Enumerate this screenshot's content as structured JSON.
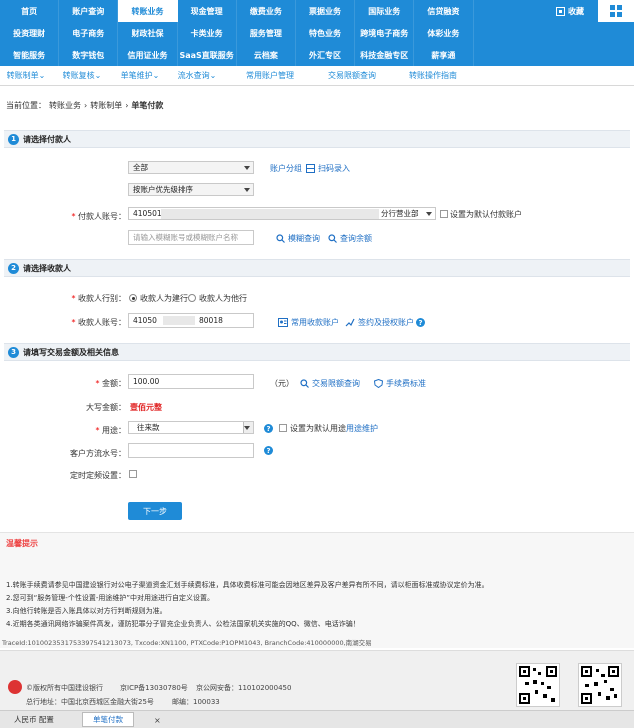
{
  "top_nav": {
    "row1": [
      "首页",
      "账户查询",
      "转账业务",
      "现金管理",
      "缴费业务",
      "票据业务",
      "国际业务",
      "信贷融资"
    ],
    "row2": [
      "投资理财",
      "电子商务",
      "财政社保",
      "卡类业务",
      "服务管理",
      "特色业务",
      "跨境电子商务",
      "体彩业务"
    ],
    "row3": [
      "智能服务",
      "数字钱包",
      "信用证业务",
      "SaaS直联服务",
      "云档案",
      "外汇专区",
      "科技金融专区",
      "薪享通"
    ],
    "active": "转账业务",
    "collect_label": "收藏"
  },
  "sub_nav": [
    "转账制单",
    "转账复核",
    "单笔维护",
    "流水查询",
    "常用账户管理",
    "交易限额查询",
    "转账操作指南"
  ],
  "breadcrumb": {
    "prefix": "当前位置：",
    "items": [
      "转账业务",
      "转账制单"
    ],
    "current": "单笔付款"
  },
  "section1": {
    "number": "1",
    "title": "请选择付款人",
    "select_all": "全部",
    "select_sort": "按账户优先级排序",
    "account_label": "付款人账号：",
    "account_prefix": "4105016",
    "account_suffix": "分行营业部",
    "set_default_label": "设置为默认付款账户",
    "search_placeholder": "请输入模糊账号或模糊账户名称",
    "link_group": "账户分组",
    "link_scan": "扫码录入",
    "link_fuzzy": "模糊查询",
    "link_balance": "查询余额"
  },
  "section2": {
    "number": "2",
    "title": "请选择收款人",
    "bank_label": "收款人行别：",
    "bank_option1": "收款人为建行",
    "bank_option2": "收款人为他行",
    "account_label": "收款人账号：",
    "account_prefix": "41050",
    "account_suffix": "80018",
    "link_common": "常用收款账户",
    "link_sign": "签约及授权账户"
  },
  "section3": {
    "number": "3",
    "title": "请填写交易金额及相关信息",
    "amount_label": "金额：",
    "amount_value": "100.00",
    "amount_unit": "（元）",
    "link_limit": "交易限额查询",
    "link_fee": "手续费标准",
    "upper_label": "大写金额：",
    "upper_value": "壹佰元整",
    "purpose_label": "用途：",
    "purpose_value": "往来款",
    "purpose_default_label": "设置为默认用途",
    "purpose_maintain": "用途维护",
    "serial_label": "客户方流水号：",
    "timer_label": "定时定频设置："
  },
  "next_button": "下一步",
  "tips": {
    "title": "温馨提示",
    "lines": [
      "1.转账手续费请参见中国建设银行对公电子渠道资金汇划手续费标准，具体收费标准可能会因地区差异及客户差异有所不同，请以柜面标准或协议定价为准。",
      "2.您可到“服务管理-个性设置-用途维护”中对用途进行自定义设置。",
      "3.向他行转账是否入账具体以对方行判断规则为准。",
      "4.近期各类通讯网络诈骗案件高发，谨防犯罪分子冒充企业负责人、公检法国家机关实施的QQ、微信、电话诈骗！"
    ]
  },
  "trace": "TraceId:1010023531753397541213073, Txcode:XN1100, PTXCode:P1OPM1043, BranchCode:410000000,南湖交易",
  "footer": {
    "copyright": "©版权所有中国建设银行",
    "icp": "京ICP备13030780号",
    "security": "京公网安备：110102000450",
    "address": "总行地址：中国北京西城区金融大街25号",
    "postcode": "邮编：100033"
  },
  "statusbar": {
    "left": "人民币  配置",
    "tab": "单笔付款",
    "close": "×"
  }
}
